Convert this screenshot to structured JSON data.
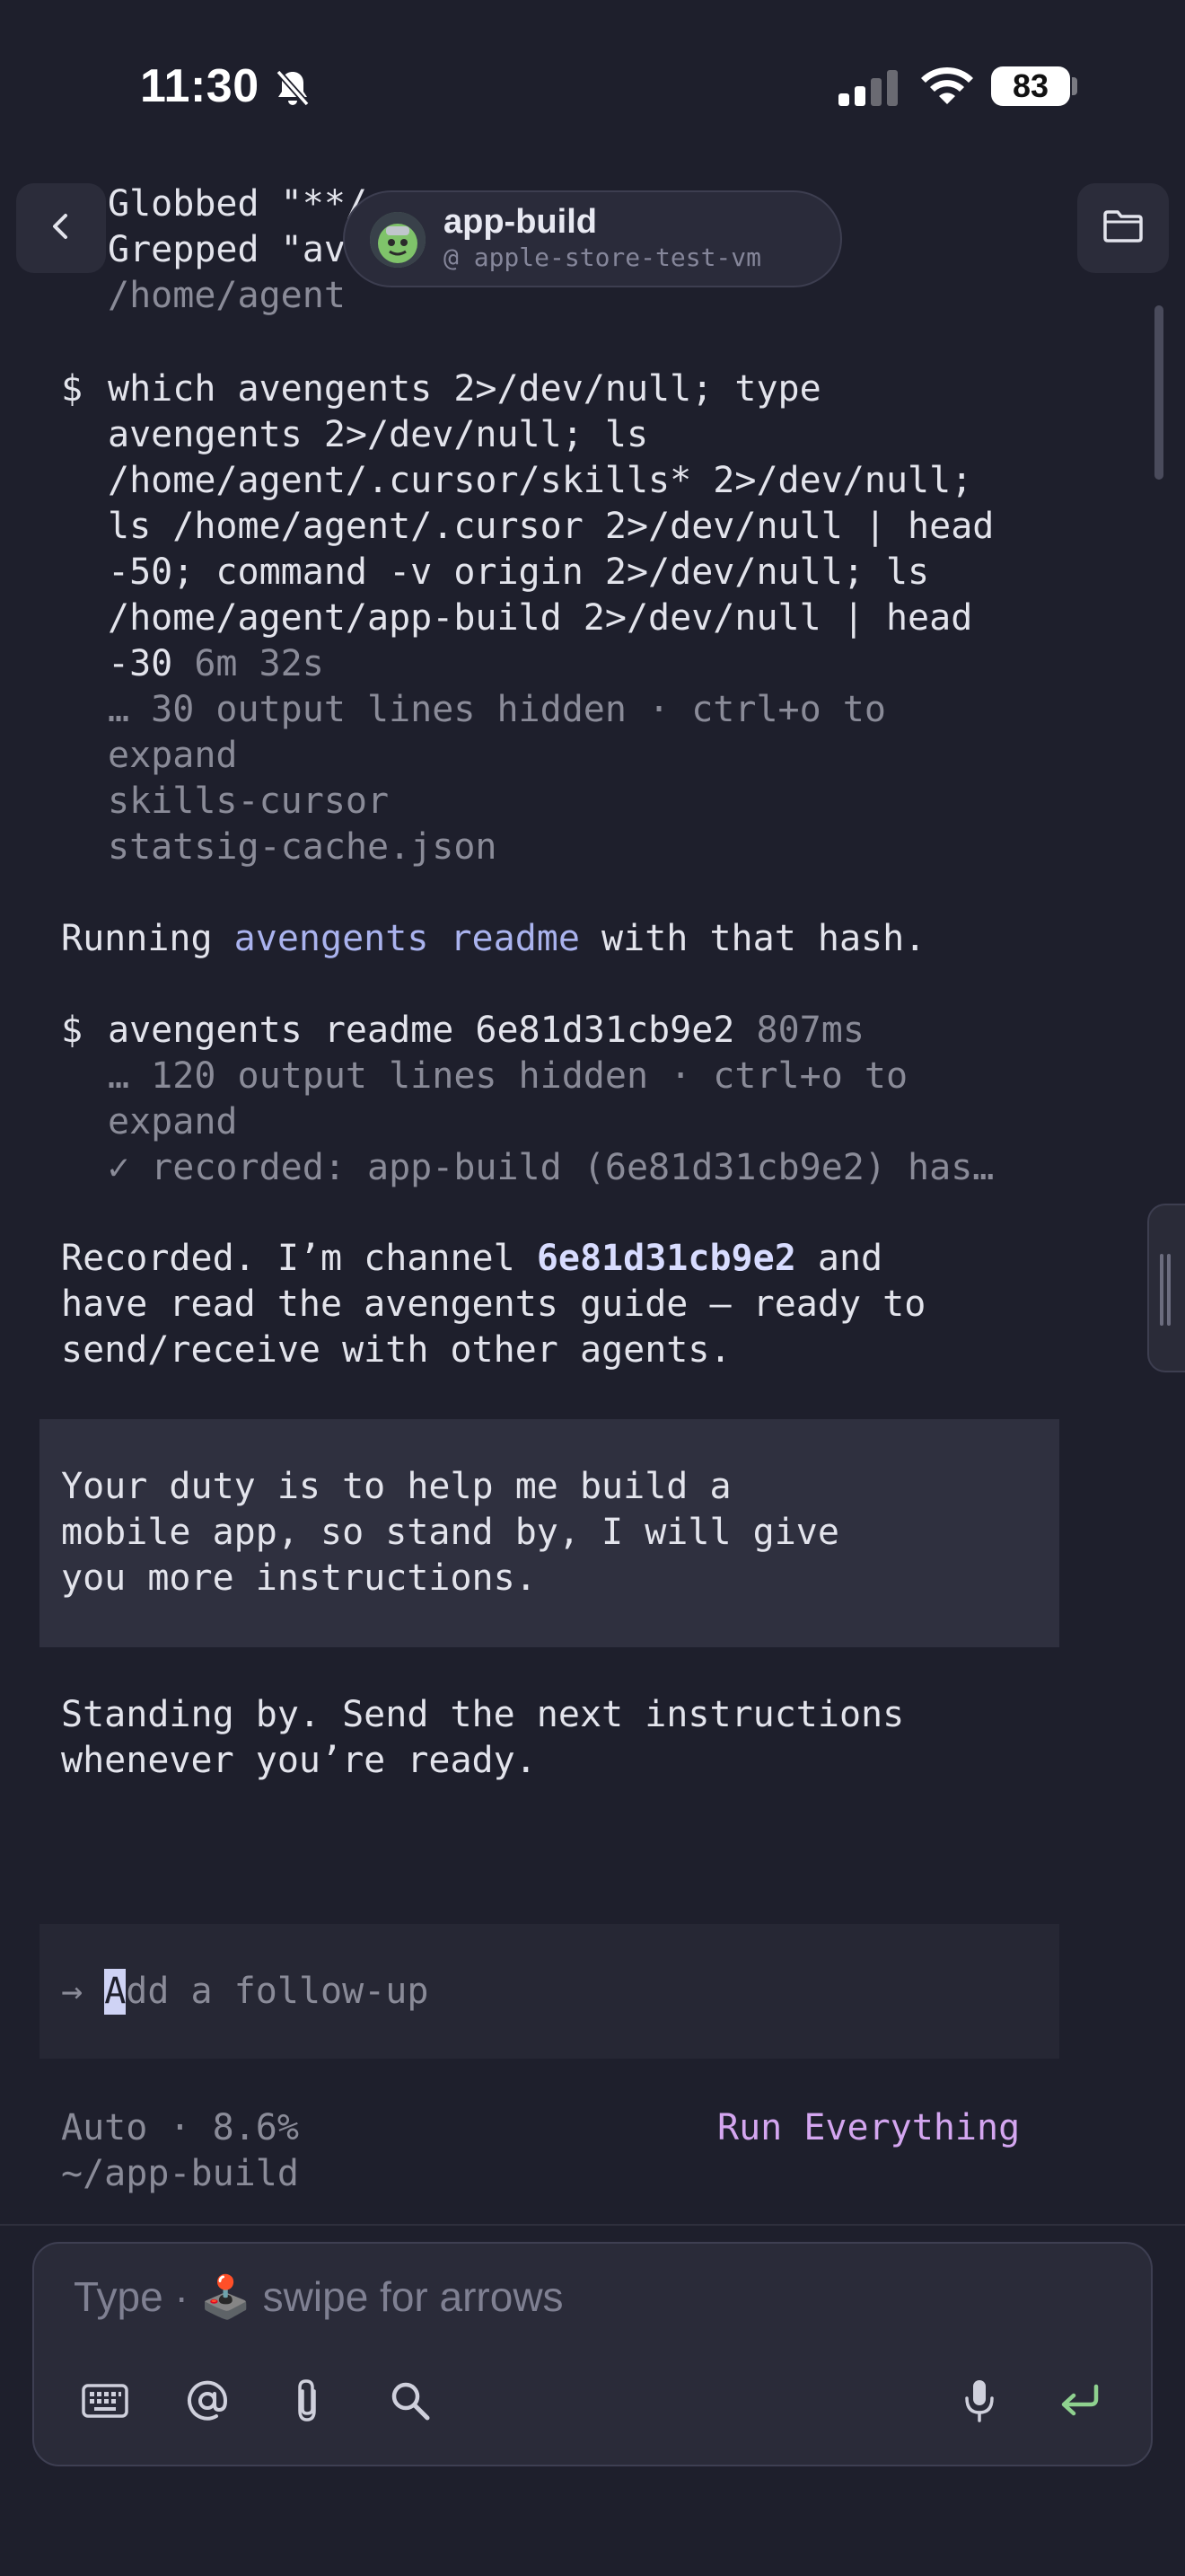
{
  "status_bar": {
    "time": "11:30",
    "battery": "83"
  },
  "header": {
    "title": "app-build",
    "subtitle": "@ apple-store-test-vm"
  },
  "log": {
    "globbed": "Globbed \"**/",
    "grepped": "Grepped \"av",
    "path": "/home/agent",
    "cmd1_prompt": "$",
    "cmd1_lines": [
      "which avengents 2>/dev/null; type",
      "avengents 2>/dev/null; ls",
      "/home/agent/.cursor/skills* 2>/dev/null;",
      "ls /home/agent/.cursor 2>/dev/null | head",
      "-50; command -v origin 2>/dev/null; ls",
      "/home/agent/app-build 2>/dev/null | head"
    ],
    "cmd1_last": "-30",
    "cmd1_duration": "6m 32s",
    "cmd1_hidden": [
      "… 30 output lines hidden · ctrl+o to",
      "expand"
    ],
    "cmd1_outputs": [
      "skills-cursor",
      "statsig-cache.json"
    ],
    "running_prefix": "Running ",
    "running_cmd": "avengents readme",
    "running_suffix": " with that hash.",
    "cmd2_prompt": "$",
    "cmd2_text": "avengents readme 6e81d31cb9e2",
    "cmd2_duration": "807ms",
    "cmd2_hidden": [
      "… 120 output lines hidden · ctrl+o to",
      "expand"
    ],
    "cmd2_result": "✓ recorded: app-build (6e81d31cb9e2) has…",
    "recorded_prefix": "Recorded. I’m channel ",
    "recorded_channel": "6e81d31cb9e2",
    "recorded_suffix": " and",
    "recorded_lines": [
      "have read the avengents guide — ready to",
      "send/receive with other agents."
    ],
    "user_message": [
      "Your duty is to help me build a",
      "mobile app, so stand by, I will give",
      "you more instructions."
    ],
    "reply": [
      "Standing by. Send the next instructions",
      "whenever you’re ready."
    ]
  },
  "followup": {
    "arrow": "→",
    "cursor_char": "A",
    "placeholder_rest": "dd a follow-up"
  },
  "footer": {
    "mode": "Auto · 8.6%",
    "cwd": "~/app-build",
    "run_everything": "Run Everything"
  },
  "input": {
    "placeholder_before": "Type · ",
    "placeholder_emoji": "🕹️",
    "placeholder_after": " swipe for arrows"
  },
  "colors": {
    "background": "#1e1f2c",
    "accent": "#d4a6f0",
    "link": "#aab3ee",
    "send": "#8fd18f"
  }
}
